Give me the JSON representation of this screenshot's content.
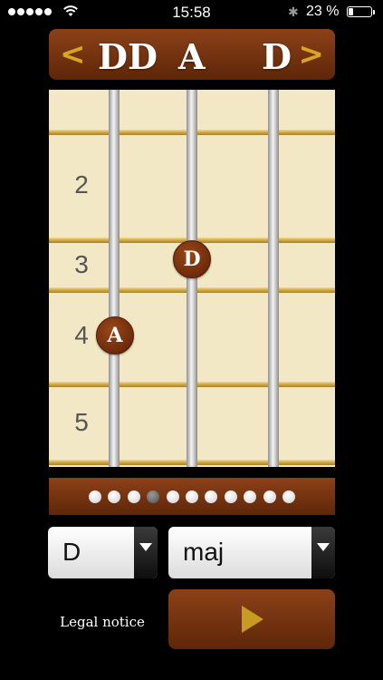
{
  "status_bar": {
    "time": "15:58",
    "battery_percent": "23 %",
    "battery_level": 0.23
  },
  "tuning": {
    "prev_label": "<",
    "next_label": ">",
    "notes": [
      "DD",
      "A",
      "D"
    ]
  },
  "fretboard": {
    "fret_numbers": [
      "2",
      "3",
      "4",
      "5"
    ],
    "markers": [
      {
        "string": 2,
        "fret": 3,
        "note": "D"
      },
      {
        "string": 1,
        "fret": 4,
        "note": "A"
      }
    ]
  },
  "pager": {
    "count": 11,
    "active_index": 3
  },
  "root_select": {
    "value": "D"
  },
  "type_select": {
    "value": "maj"
  },
  "legal_label": "Legal notice",
  "play_button": {
    "icon": "play-icon"
  }
}
